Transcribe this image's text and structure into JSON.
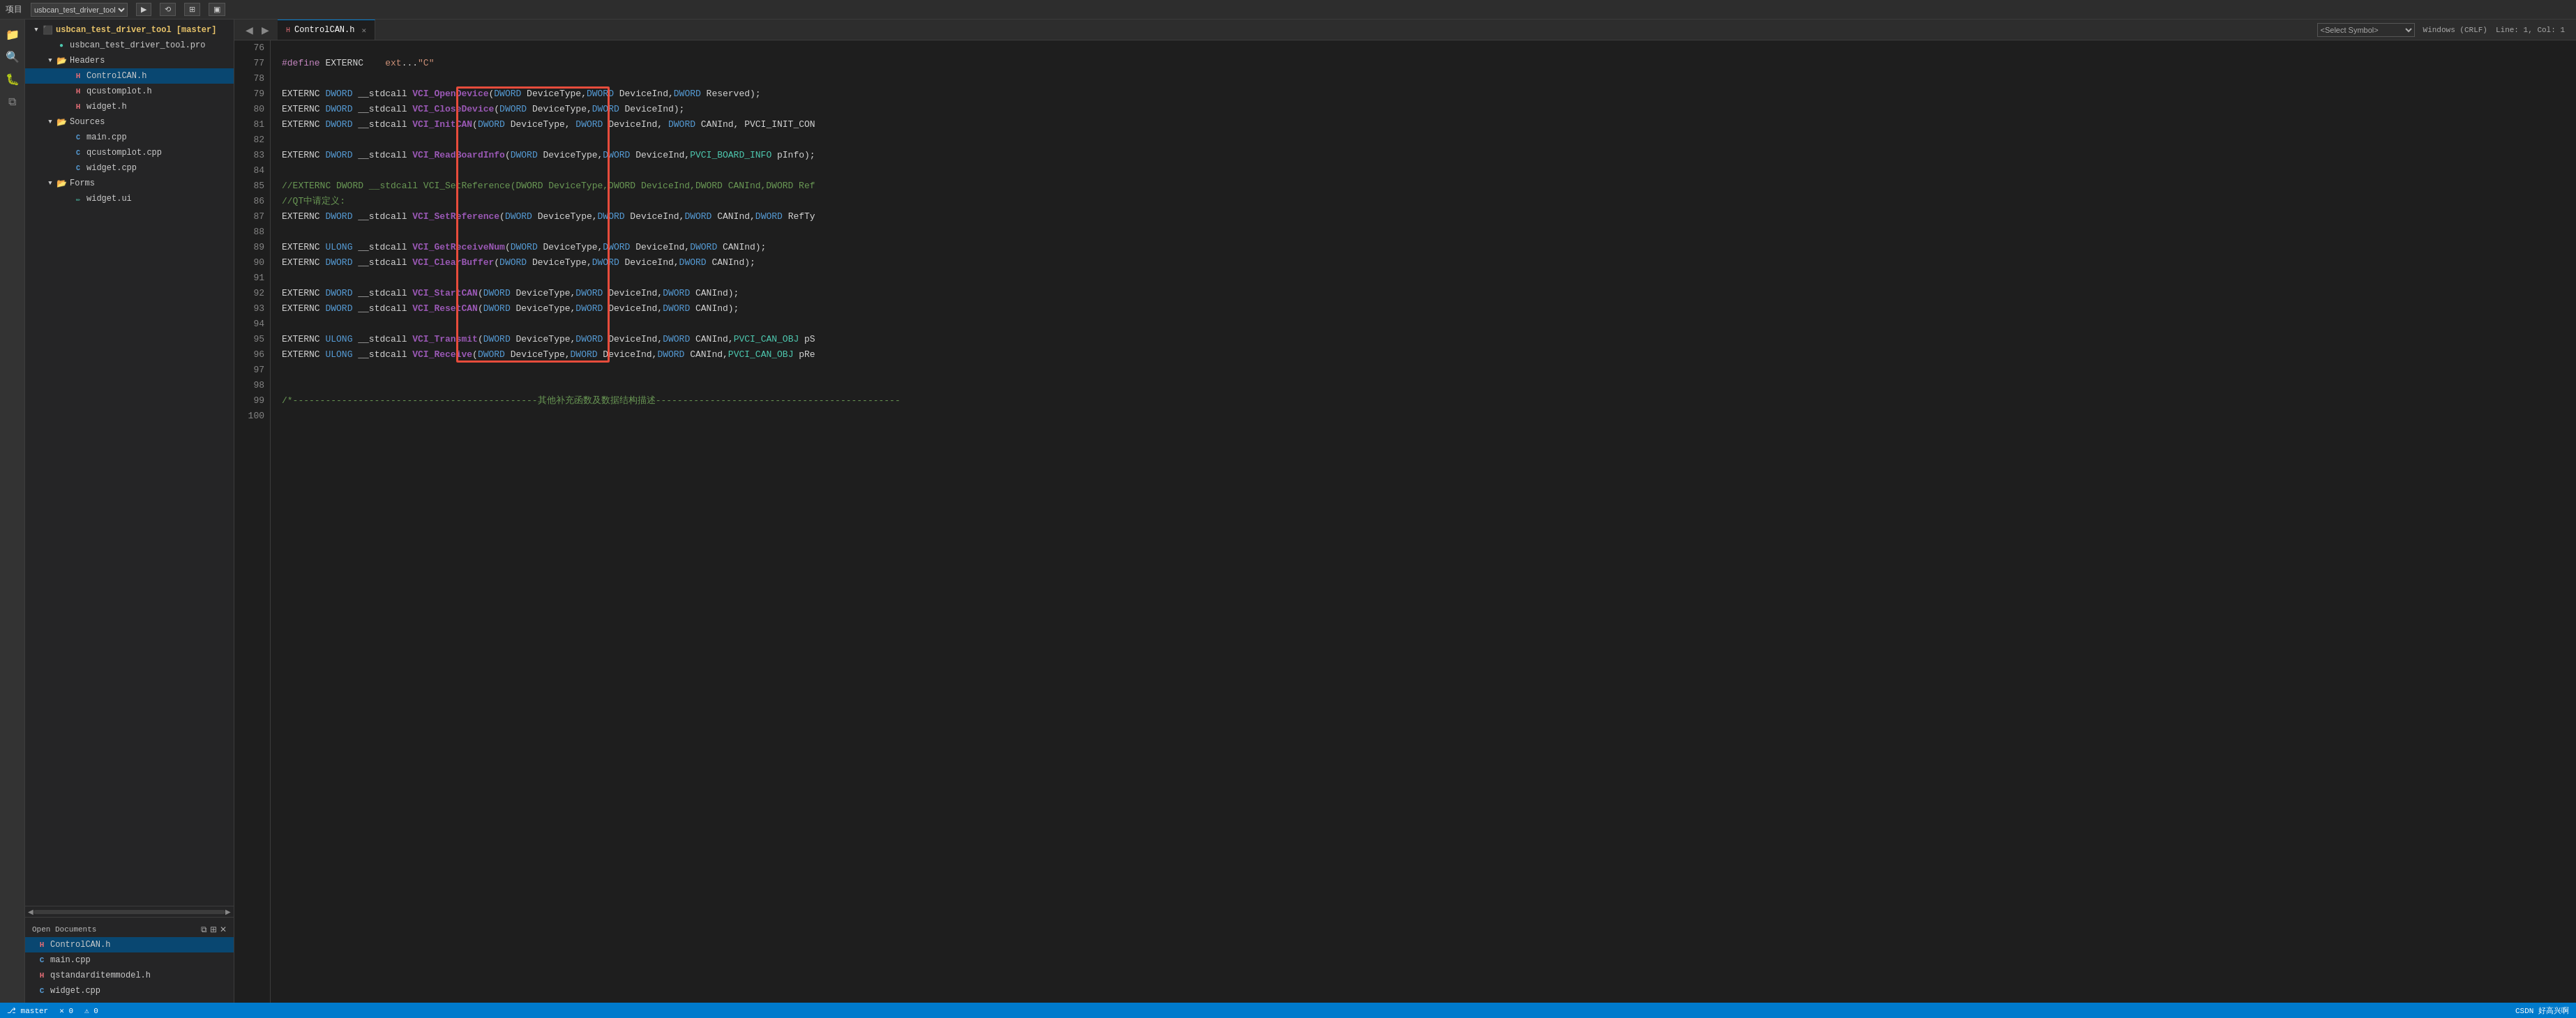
{
  "topbar": {
    "title": "项目"
  },
  "tabs": {
    "active": "ControlCAN.h",
    "items": [
      {
        "label": "ControlCAN.h",
        "icon": "h",
        "active": true
      }
    ],
    "nav_back": "◀",
    "nav_forward": "▶",
    "symbol_placeholder": "<Select Symbol>",
    "encoding": "Windows (CRLF)",
    "position": "Line: 1, Col: 1"
  },
  "sidebar": {
    "project_root": "usbcan_test_driver_tool [master]",
    "project_file": "usbcan_test_driver_tool.pro",
    "headers_label": "Headers",
    "headers_files": [
      "ControlCAN.h",
      "qcustomplot.h",
      "widget.h"
    ],
    "sources_label": "Sources",
    "sources_files": [
      "main.cpp",
      "qcustomplot.cpp",
      "widget.cpp"
    ],
    "forms_label": "Forms",
    "forms_files": [
      "widget.ui"
    ],
    "open_docs_label": "Open Documents",
    "open_docs_files": [
      "ControlCAN.h",
      "main.cpp",
      "qstandarditemmodel.h",
      "widget.cpp"
    ]
  },
  "code": {
    "lines": [
      {
        "num": 76,
        "text": ""
      },
      {
        "num": 77,
        "tokens": [
          {
            "t": "macro-def",
            "v": "#define"
          },
          {
            "t": "plain",
            "v": " EXTERNC    "
          },
          {
            "t": "str",
            "v": "ext"
          },
          {
            "t": "plain",
            "v": "..."
          },
          {
            "t": "str",
            "v": "\"C\""
          }
        ]
      },
      {
        "num": 78,
        "text": ""
      },
      {
        "num": 79,
        "tokens": [
          {
            "t": "plain",
            "v": "EXTERNC "
          },
          {
            "t": "kw",
            "v": "DWORD"
          },
          {
            "t": "plain",
            "v": " __stdcal"
          },
          {
            "t": "plain",
            "v": "l "
          },
          {
            "t": "fn-purple",
            "v": "VCI_OpenDevice"
          },
          {
            "t": "plain",
            "v": "("
          },
          {
            "t": "kw",
            "v": "DWORD"
          },
          {
            "t": "plain",
            "v": " DeviceType,"
          },
          {
            "t": "kw",
            "v": "DWORD"
          },
          {
            "t": "plain",
            "v": " DeviceInd,"
          },
          {
            "t": "kw",
            "v": "DWORD"
          },
          {
            "t": "plain",
            "v": " Reserved);"
          }
        ]
      },
      {
        "num": 80,
        "tokens": [
          {
            "t": "plain",
            "v": "EXTERNC "
          },
          {
            "t": "kw",
            "v": "DWORD"
          },
          {
            "t": "plain",
            "v": " __stdcal"
          },
          {
            "t": "plain",
            "v": "l "
          },
          {
            "t": "fn-purple",
            "v": "VCI_CloseDevice"
          },
          {
            "t": "plain",
            "v": "("
          },
          {
            "t": "kw",
            "v": "DWORD"
          },
          {
            "t": "plain",
            "v": " DeviceType,"
          },
          {
            "t": "kw",
            "v": "DWORD"
          },
          {
            "t": "plain",
            "v": " DeviceInd);"
          }
        ]
      },
      {
        "num": 81,
        "tokens": [
          {
            "t": "plain",
            "v": "EXTERNC "
          },
          {
            "t": "kw",
            "v": "DWORD"
          },
          {
            "t": "plain",
            "v": " __stdcal"
          },
          {
            "t": "plain",
            "v": "l "
          },
          {
            "t": "fn-purple",
            "v": "VCI_InitCAN"
          },
          {
            "t": "plain",
            "v": "("
          },
          {
            "t": "kw",
            "v": "DWORD"
          },
          {
            "t": "plain",
            "v": " DeviceType, "
          },
          {
            "t": "kw",
            "v": "DWORD"
          },
          {
            "t": "plain",
            "v": " DeviceInd, "
          },
          {
            "t": "kw",
            "v": "DWORD"
          },
          {
            "t": "plain",
            "v": " CANInd, PVCI_INIT_CON"
          }
        ]
      },
      {
        "num": 82,
        "text": ""
      },
      {
        "num": 83,
        "tokens": [
          {
            "t": "plain",
            "v": "EXTERNC "
          },
          {
            "t": "kw",
            "v": "DWORD"
          },
          {
            "t": "plain",
            "v": " __stdcal"
          },
          {
            "t": "plain",
            "v": "l "
          },
          {
            "t": "fn-purple",
            "v": "VCI_ReadBoardInfo"
          },
          {
            "t": "plain",
            "v": "("
          },
          {
            "t": "kw",
            "v": "DWORD"
          },
          {
            "t": "plain",
            "v": " DeviceType,"
          },
          {
            "t": "kw",
            "v": "DWORD"
          },
          {
            "t": "plain",
            "v": " DeviceInd,"
          },
          {
            "t": "teal",
            "v": "PVCI_BOARD_INFO"
          },
          {
            "t": "plain",
            "v": " pInfo);"
          }
        ]
      },
      {
        "num": 84,
        "text": ""
      },
      {
        "num": 85,
        "tokens": [
          {
            "t": "comment",
            "v": "//EXTERNC DWORD __stdcall VCI_SetReference(DWORD DeviceType,DWORD DeviceInd,DWORD CANInd,DWORD Ref"
          }
        ]
      },
      {
        "num": 86,
        "tokens": [
          {
            "t": "comment",
            "v": "//QT中请定义:"
          }
        ]
      },
      {
        "num": 87,
        "tokens": [
          {
            "t": "plain",
            "v": "EXTERNC "
          },
          {
            "t": "kw",
            "v": "DWORD"
          },
          {
            "t": "plain",
            "v": " __stdcal"
          },
          {
            "t": "plain",
            "v": "l "
          },
          {
            "t": "fn-purple",
            "v": "VCI_SetReference"
          },
          {
            "t": "plain",
            "v": "("
          },
          {
            "t": "kw",
            "v": "DWORD"
          },
          {
            "t": "plain",
            "v": " DeviceType,"
          },
          {
            "t": "kw",
            "v": "DWORD"
          },
          {
            "t": "plain",
            "v": " DeviceInd,"
          },
          {
            "t": "kw",
            "v": "DWORD"
          },
          {
            "t": "plain",
            "v": " CANInd,"
          },
          {
            "t": "kw",
            "v": "DWORD"
          },
          {
            "t": "plain",
            "v": " RefTy"
          }
        ]
      },
      {
        "num": 88,
        "text": ""
      },
      {
        "num": 89,
        "tokens": [
          {
            "t": "plain",
            "v": "EXTERNC "
          },
          {
            "t": "kw",
            "v": "ULONG"
          },
          {
            "t": "plain",
            "v": " __stdcal"
          },
          {
            "t": "plain",
            "v": "l "
          },
          {
            "t": "fn-purple",
            "v": "VCI_GetReceiveNum"
          },
          {
            "t": "plain",
            "v": "("
          },
          {
            "t": "kw",
            "v": "DWORD"
          },
          {
            "t": "plain",
            "v": " DeviceType,"
          },
          {
            "t": "kw",
            "v": "DWORD"
          },
          {
            "t": "plain",
            "v": " DeviceInd,"
          },
          {
            "t": "kw",
            "v": "DWORD"
          },
          {
            "t": "plain",
            "v": " CANInd);"
          }
        ]
      },
      {
        "num": 90,
        "tokens": [
          {
            "t": "plain",
            "v": "EXTERNC "
          },
          {
            "t": "kw",
            "v": "DWORD"
          },
          {
            "t": "plain",
            "v": " __stdcal"
          },
          {
            "t": "plain",
            "v": "l "
          },
          {
            "t": "fn-purple",
            "v": "VCI_ClearBuffer"
          },
          {
            "t": "plain",
            "v": "("
          },
          {
            "t": "kw",
            "v": "DWORD"
          },
          {
            "t": "plain",
            "v": " DeviceType,"
          },
          {
            "t": "kw",
            "v": "DWORD"
          },
          {
            "t": "plain",
            "v": " DeviceInd,"
          },
          {
            "t": "kw",
            "v": "DWORD"
          },
          {
            "t": "plain",
            "v": " CANInd);"
          }
        ]
      },
      {
        "num": 91,
        "text": ""
      },
      {
        "num": 92,
        "tokens": [
          {
            "t": "plain",
            "v": "EXTERNC "
          },
          {
            "t": "kw",
            "v": "DWORD"
          },
          {
            "t": "plain",
            "v": " __stdcal"
          },
          {
            "t": "plain",
            "v": "l "
          },
          {
            "t": "fn-purple",
            "v": "VCI_StartCAN"
          },
          {
            "t": "plain",
            "v": "("
          },
          {
            "t": "kw",
            "v": "DWORD"
          },
          {
            "t": "plain",
            "v": " DeviceType,"
          },
          {
            "t": "kw",
            "v": "DWORD"
          },
          {
            "t": "plain",
            "v": " DeviceInd,"
          },
          {
            "t": "kw",
            "v": "DWORD"
          },
          {
            "t": "plain",
            "v": " CANInd);"
          }
        ]
      },
      {
        "num": 93,
        "tokens": [
          {
            "t": "plain",
            "v": "EXTERNC "
          },
          {
            "t": "kw",
            "v": "DWORD"
          },
          {
            "t": "plain",
            "v": " __stdcal"
          },
          {
            "t": "plain",
            "v": "l "
          },
          {
            "t": "fn-purple",
            "v": "VCI_ResetCAN"
          },
          {
            "t": "plain",
            "v": "("
          },
          {
            "t": "kw",
            "v": "DWORD"
          },
          {
            "t": "plain",
            "v": " DeviceType,"
          },
          {
            "t": "kw",
            "v": "DWORD"
          },
          {
            "t": "plain",
            "v": " DeviceInd,"
          },
          {
            "t": "kw",
            "v": "DWORD"
          },
          {
            "t": "plain",
            "v": " CANInd);"
          }
        ]
      },
      {
        "num": 94,
        "text": ""
      },
      {
        "num": 95,
        "tokens": [
          {
            "t": "plain",
            "v": "EXTERNC "
          },
          {
            "t": "kw",
            "v": "ULONG"
          },
          {
            "t": "plain",
            "v": " __stdcal"
          },
          {
            "t": "plain",
            "v": "l "
          },
          {
            "t": "fn-purple",
            "v": "VCI_Transmit"
          },
          {
            "t": "plain",
            "v": "("
          },
          {
            "t": "kw",
            "v": "DWORD"
          },
          {
            "t": "plain",
            "v": " DeviceType,"
          },
          {
            "t": "kw",
            "v": "DWORD"
          },
          {
            "t": "plain",
            "v": " DeviceInd,"
          },
          {
            "t": "kw",
            "v": "DWORD"
          },
          {
            "t": "plain",
            "v": " CANInd,"
          },
          {
            "t": "teal",
            "v": "PVCI_CAN_OBJ"
          },
          {
            "t": "plain",
            "v": " pS"
          }
        ]
      },
      {
        "num": 96,
        "tokens": [
          {
            "t": "plain",
            "v": "EXTERNC "
          },
          {
            "t": "kw",
            "v": "ULONG"
          },
          {
            "t": "plain",
            "v": " __stdcal"
          },
          {
            "t": "plain",
            "v": "l "
          },
          {
            "t": "fn-purple",
            "v": "VCI_Receive"
          },
          {
            "t": "plain",
            "v": "("
          },
          {
            "t": "kw",
            "v": "DWORD"
          },
          {
            "t": "plain",
            "v": " DeviceType,"
          },
          {
            "t": "kw",
            "v": "DWORD"
          },
          {
            "t": "plain",
            "v": " DeviceInd,"
          },
          {
            "t": "kw",
            "v": "DWORD"
          },
          {
            "t": "plain",
            "v": " CANInd,"
          },
          {
            "t": "teal",
            "v": "PVCI_CAN_OBJ"
          },
          {
            "t": "plain",
            "v": " pRe"
          }
        ]
      },
      {
        "num": 97,
        "text": ""
      },
      {
        "num": 98,
        "text": ""
      },
      {
        "num": 99,
        "tokens": [
          {
            "t": "comment",
            "v": "/*---------------------------------------------其他补充函数及数据结构描述---------------------------------------------"
          }
        ]
      },
      {
        "num": 100,
        "text": ""
      }
    ]
  },
  "statusbar": {
    "branch": "master",
    "errors": "0",
    "warnings": "0",
    "info": "CSDN 好高兴啊"
  }
}
